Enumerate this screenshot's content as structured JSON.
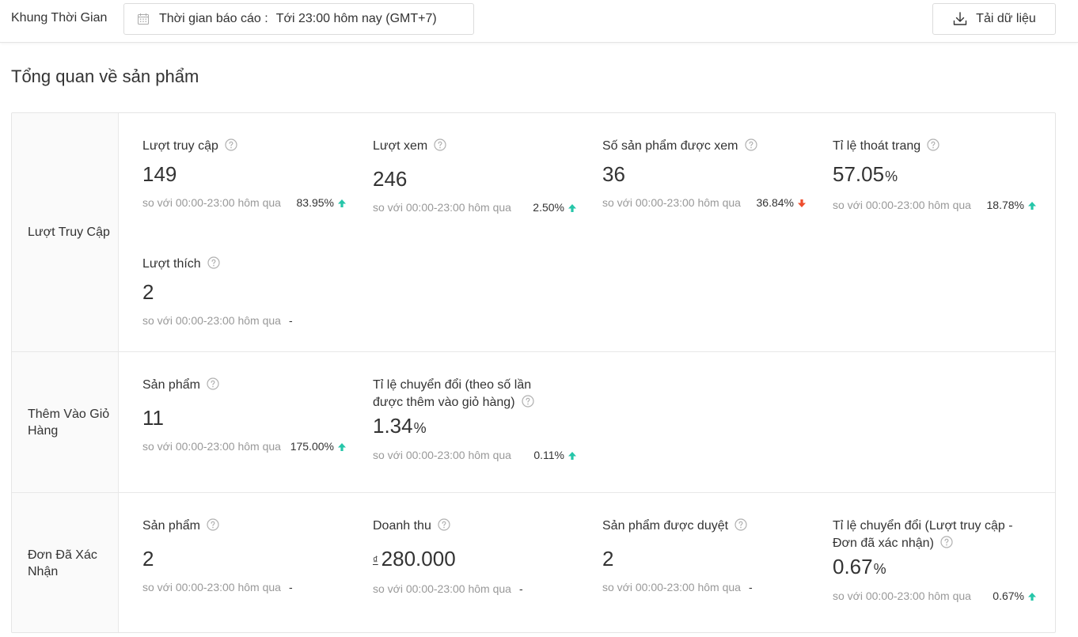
{
  "header": {
    "timeframe_label": "Khung Thời Gian",
    "date_prefix": "Thời gian báo cáo :",
    "date_value": "Tới 23:00 hôm nay (GMT+7)",
    "download_label": "Tải dữ liệu"
  },
  "section_title": "Tổng quan về sản phẩm",
  "colors": {
    "up": "#26c6a9",
    "down": "#ee4d2d",
    "muted": "#999999",
    "text": "#333333"
  },
  "rows": [
    {
      "label": "Lượt Truy Cập",
      "metrics": [
        {
          "title": "Lượt truy cập",
          "value": "149",
          "compare_text": "so với 00:00-23:00 hôm qua",
          "change": "83.95%",
          "trend": "up"
        },
        {
          "title": "Lượt xem",
          "value": "246",
          "compare_text": "so với 00:00-23:00 hôm qua",
          "change": "2.50%",
          "trend": "up"
        },
        {
          "title": "Số sản phẩm được xem",
          "value": "36",
          "compare_text": "so với 00:00-23:00 hôm qua",
          "change": "36.84%",
          "trend": "down"
        },
        {
          "title": "Tỉ lệ thoát trang",
          "value": "57.05",
          "unit": "%",
          "compare_text": "so với 00:00-23:00 hôm qua",
          "change": "18.78%",
          "trend": "up"
        },
        {
          "title": "Lượt thích",
          "value": "2",
          "compare_text": "so với 00:00-23:00 hôm qua",
          "change": "-",
          "trend": "none"
        }
      ]
    },
    {
      "label": "Thêm Vào Giỏ Hàng",
      "metrics": [
        {
          "title": "Sản phẩm",
          "value": "11",
          "compare_text": "so với 00:00-23:00 hôm qua",
          "change": "175.00%",
          "trend": "up"
        },
        {
          "title": "Tỉ lệ chuyển đổi (theo số lần được thêm vào giỏ hàng)",
          "value": "1.34",
          "unit": "%",
          "compare_text": "so với 00:00-23:00 hôm qua",
          "change": "0.11%",
          "trend": "up"
        }
      ]
    },
    {
      "label": "Đơn Đã Xác Nhận",
      "metrics": [
        {
          "title": "Sản phẩm",
          "value": "2",
          "compare_text": "so với 00:00-23:00 hôm qua",
          "change": "-",
          "trend": "none"
        },
        {
          "title": "Doanh thu",
          "currency": "₫",
          "value": "280.000",
          "compare_text": "so với 00:00-23:00 hôm qua",
          "change": "-",
          "trend": "none"
        },
        {
          "title": "Sản phẩm được duyệt",
          "value": "2",
          "compare_text": "so với 00:00-23:00 hôm qua",
          "change": "-",
          "trend": "none"
        },
        {
          "title": "Tỉ lệ chuyển đổi (Lượt truy cập - Đơn đã xác nhận)",
          "value": "0.67",
          "unit": "%",
          "compare_text": "so với 00:00-23:00 hôm qua",
          "change": "0.67%",
          "trend": "up"
        }
      ]
    }
  ]
}
